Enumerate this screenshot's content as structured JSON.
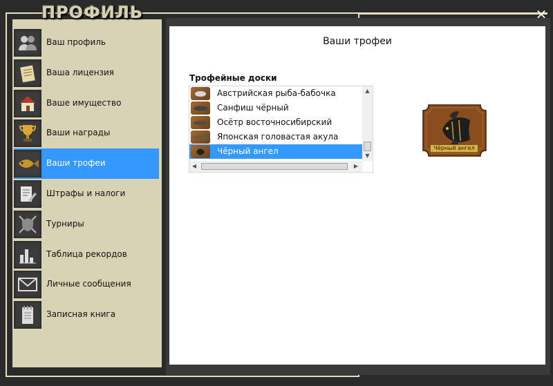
{
  "window": {
    "title": "ПРОФИЛЬ",
    "close_icon": "close-icon"
  },
  "sidebar": {
    "items": [
      {
        "label": "Ваш профиль",
        "icon": "users-icon"
      },
      {
        "label": "Ваша лицензия",
        "icon": "license-icon"
      },
      {
        "label": "Ваше имущество",
        "icon": "house-icon"
      },
      {
        "label": "Ваши награды",
        "icon": "trophy-cup-icon"
      },
      {
        "label": "Ваши трофеи",
        "icon": "fish-trophy-icon",
        "active": true
      },
      {
        "label": "Штрафы и налоги",
        "icon": "document-pencil-icon"
      },
      {
        "label": "Турниры",
        "icon": "shield-swords-icon"
      },
      {
        "label": "Таблица рекордов",
        "icon": "bar-chart-icon"
      },
      {
        "label": "Личные сообщения",
        "icon": "envelope-icon"
      },
      {
        "label": "Записная книга",
        "icon": "notebook-icon"
      }
    ]
  },
  "main": {
    "title": "Ваши трофеи",
    "boards_label": "Трофейные доски",
    "boards": [
      {
        "label": "Австрийская рыба-бабочка"
      },
      {
        "label": "Санфиш чёрный"
      },
      {
        "label": "Осётр восточносибирский"
      },
      {
        "label": "Японская головастая акула"
      },
      {
        "label": "Чёрный ангел",
        "selected": true
      }
    ],
    "preview": {
      "caption": "Чёрный ангел"
    }
  },
  "colors": {
    "accent": "#3399ff",
    "sidebar_bg": "#d7d3b4",
    "frame": "#2a2a2a"
  }
}
